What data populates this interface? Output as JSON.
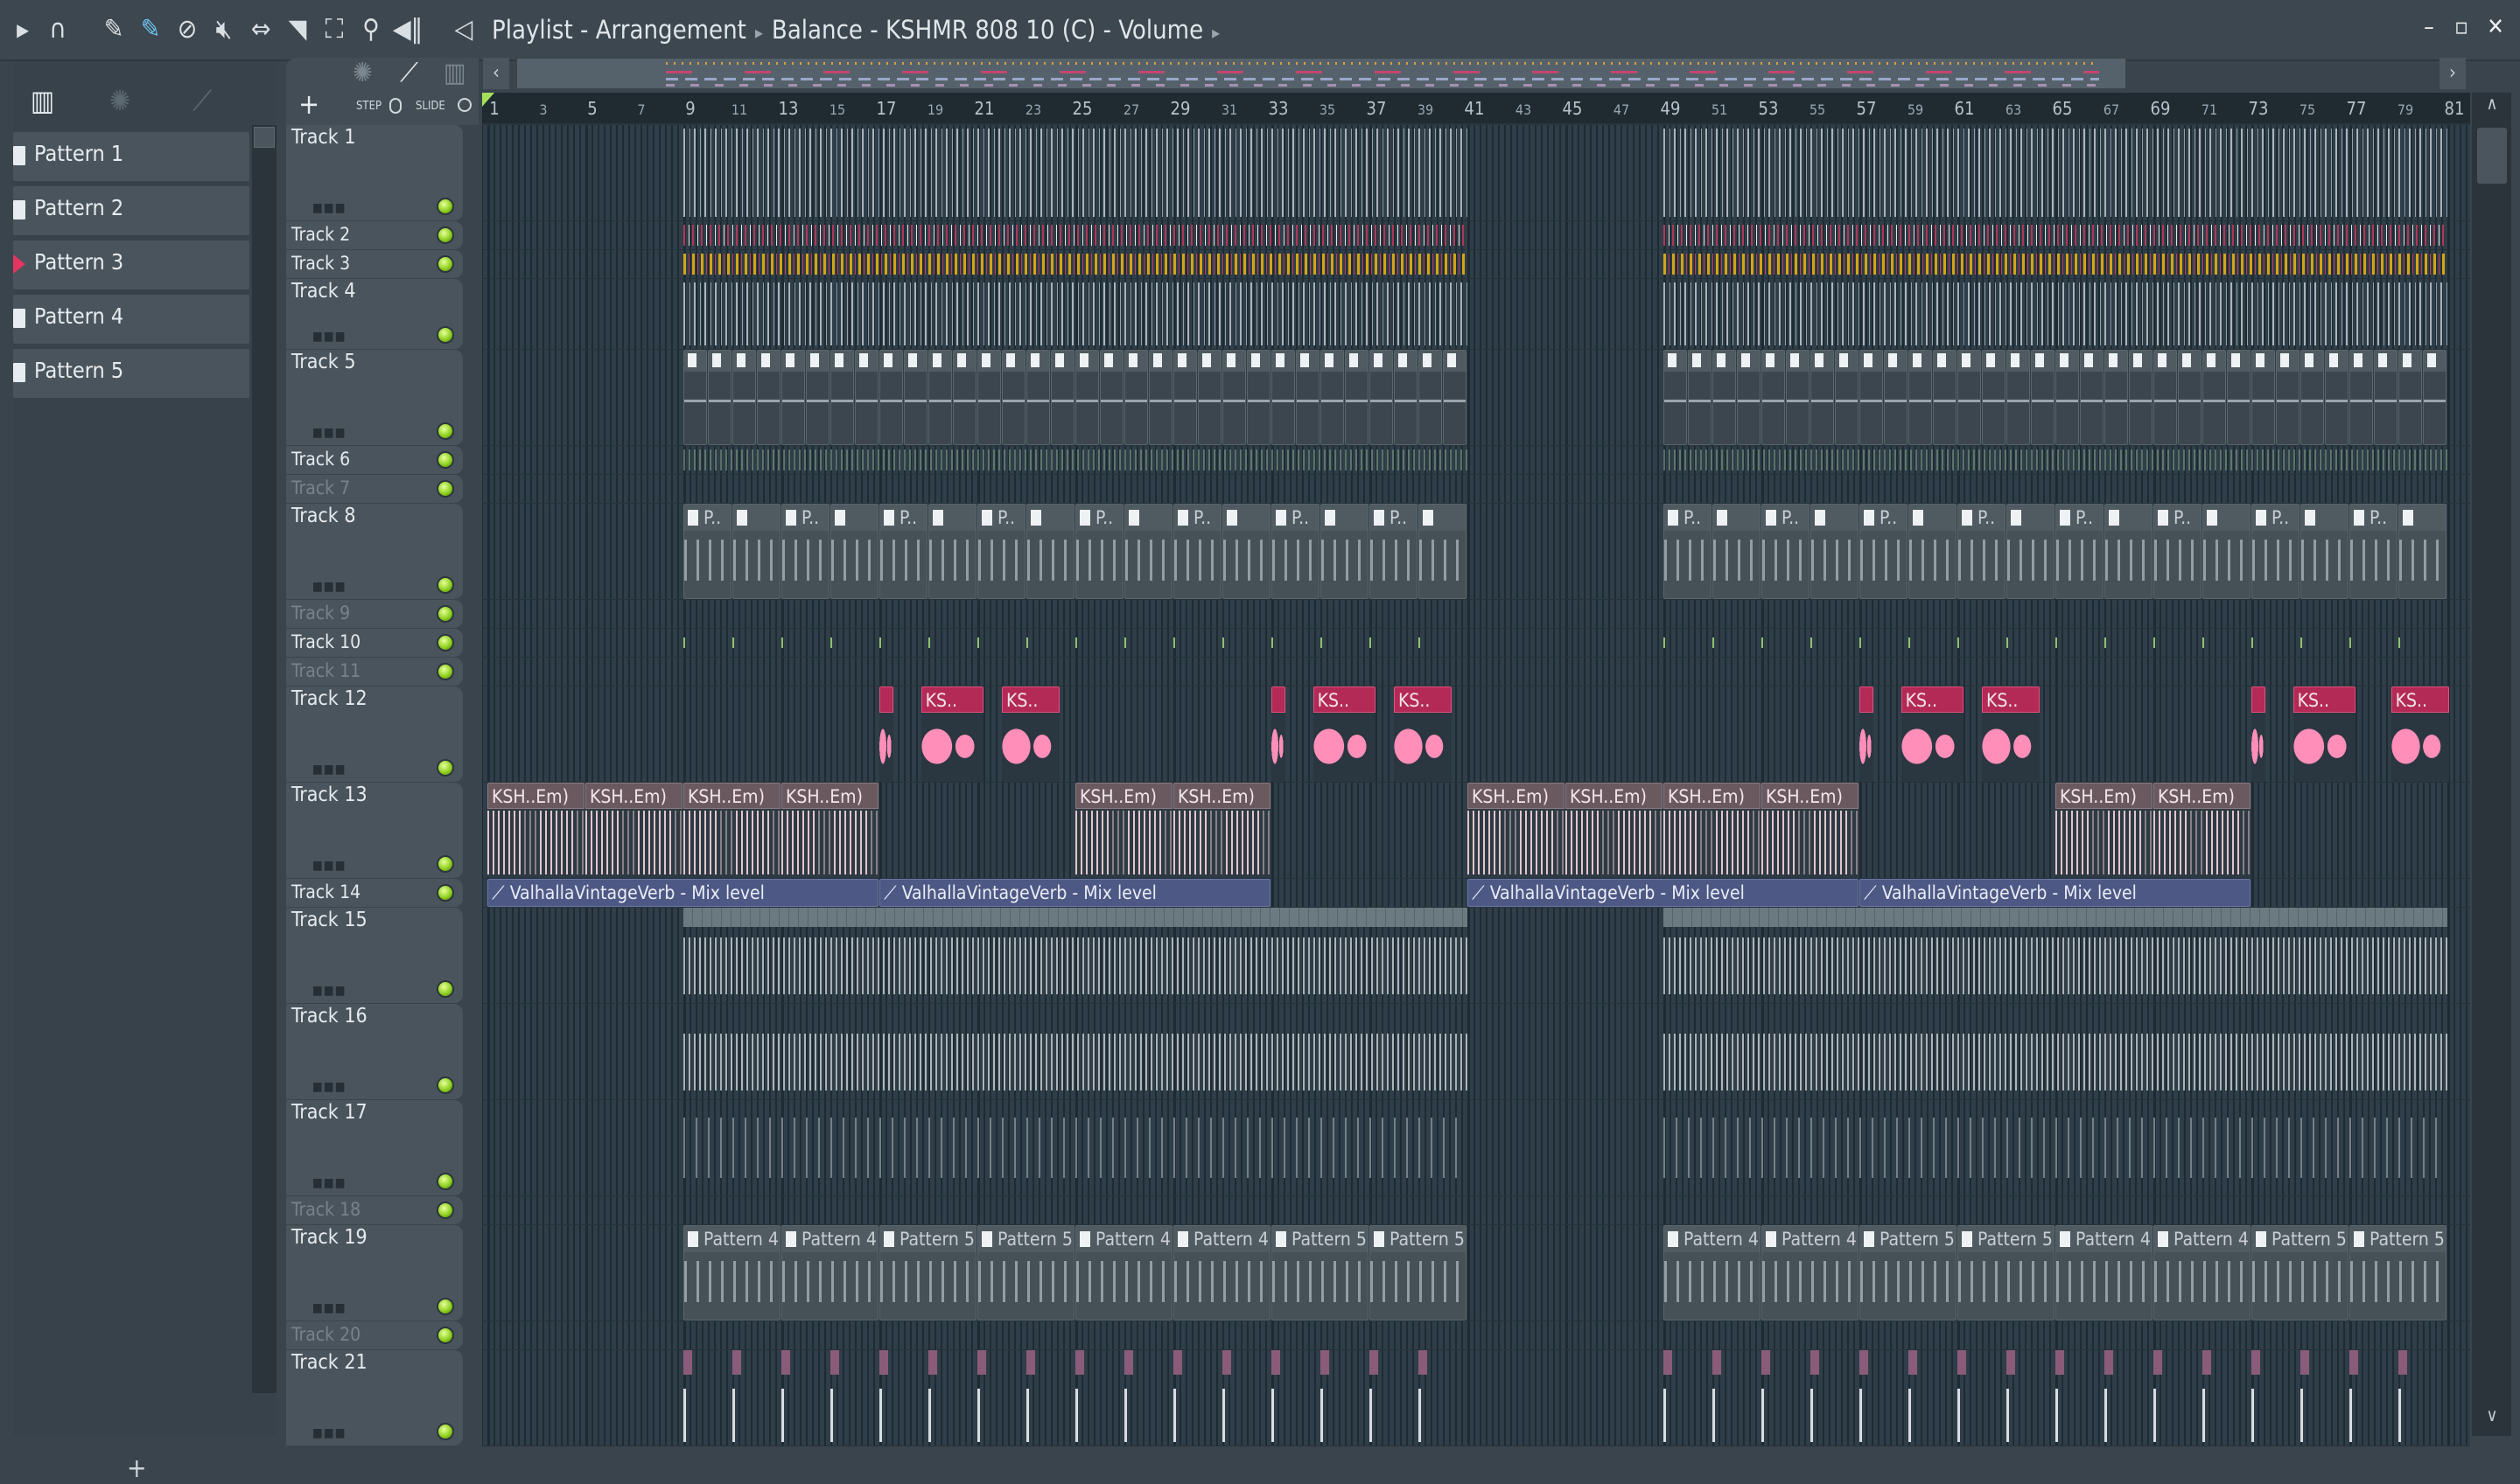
{
  "toolbar": {
    "icons": [
      "play-arrow-icon",
      "magnet-snap-icon",
      "pencil-icon",
      "paint-icon",
      "delete-icon",
      "mute-icon",
      "slip-icon",
      "slice-icon",
      "select-icon",
      "zoom-icon",
      "playback-icon"
    ],
    "title": "Playlist - Arrangement",
    "subtitle": "Balance - KSHMR 808 10 (C) - Volume",
    "separator": "▸"
  },
  "header_tools": {
    "add": "+",
    "step": "STEP",
    "slide": "SLIDE"
  },
  "patterns": [
    {
      "name": "Pattern 1"
    },
    {
      "name": "Pattern 2"
    },
    {
      "name": "Pattern 3",
      "playing": true
    },
    {
      "name": "Pattern 4"
    },
    {
      "name": "Pattern 5"
    }
  ],
  "add_pattern": "+",
  "ruler": {
    "labels": [
      1,
      3,
      5,
      7,
      9,
      11,
      13,
      15,
      17,
      19,
      21,
      23,
      25,
      27,
      29,
      31,
      33,
      35,
      37,
      39,
      41,
      43,
      45,
      47,
      49,
      51,
      53,
      55,
      57,
      59,
      61,
      63,
      65,
      67,
      69,
      71,
      73,
      75,
      77,
      79,
      81
    ]
  },
  "tracks": [
    {
      "name": "Track 1",
      "regions": [
        [
          9,
          41,
          "white"
        ],
        [
          49,
          81,
          "white"
        ]
      ]
    },
    {
      "name": "Track 2",
      "regions": [
        [
          9,
          41,
          "red"
        ],
        [
          49,
          81,
          "red"
        ]
      ]
    },
    {
      "name": "Track 3",
      "regions": [
        [
          9,
          41,
          "yellow"
        ],
        [
          49,
          81,
          "yellow"
        ]
      ]
    },
    {
      "name": "Track 4",
      "regions": [
        [
          9,
          41,
          "white"
        ],
        [
          49,
          81,
          "white"
        ]
      ]
    },
    {
      "name": "Track 5",
      "runs": [
        {
          "from": 9,
          "to": 41,
          "step": 1,
          "kind": "small",
          "labels": [
            ""
          ]
        },
        {
          "from": 49,
          "to": 81,
          "step": 1,
          "kind": "small",
          "labels": [
            ""
          ]
        }
      ]
    },
    {
      "name": "Track 6",
      "regions": [
        [
          9,
          41,
          "green"
        ],
        [
          49,
          81,
          "green"
        ]
      ]
    },
    {
      "name": "Track 7",
      "dim": true
    },
    {
      "name": "Track 8",
      "runs": [
        {
          "from": 9,
          "to": 41,
          "step": 2,
          "kind": "pat",
          "labels": [
            "P..",
            ""
          ]
        },
        {
          "from": 49,
          "to": 81,
          "step": 2,
          "kind": "pat",
          "labels": [
            "P..",
            ""
          ]
        }
      ]
    },
    {
      "name": "Track 9",
      "dim": true
    },
    {
      "name": "Track 10",
      "regions": [
        [
          9,
          41,
          "tick"
        ],
        [
          49,
          81,
          "tick"
        ]
      ]
    },
    {
      "name": "Track 11",
      "dim": true
    },
    {
      "name": "Track 12",
      "clips": [
        {
          "start": 17,
          "len": 0.6,
          "label": "",
          "kind": "pink"
        },
        {
          "start": 18.7,
          "len": 2.6,
          "label": "KS..",
          "kind": "pink"
        },
        {
          "start": 22,
          "len": 2.4,
          "label": "KS..",
          "kind": "pink"
        },
        {
          "start": 33,
          "len": 0.6,
          "label": "",
          "kind": "pink"
        },
        {
          "start": 34.7,
          "len": 2.6,
          "label": "KS..",
          "kind": "pink"
        },
        {
          "start": 38,
          "len": 2.4,
          "label": "KS..",
          "kind": "pink"
        },
        {
          "start": 57,
          "len": 0.6,
          "label": "",
          "kind": "pink"
        },
        {
          "start": 58.7,
          "len": 2.6,
          "label": "KS..",
          "kind": "pink"
        },
        {
          "start": 62,
          "len": 2.4,
          "label": "KS..",
          "kind": "pink"
        },
        {
          "start": 73,
          "len": 0.6,
          "label": "",
          "kind": "pink"
        },
        {
          "start": 74.7,
          "len": 2.6,
          "label": "KS..",
          "kind": "pink"
        },
        {
          "start": 78.7,
          "len": 2.4,
          "label": "KS..",
          "kind": "pink"
        }
      ]
    },
    {
      "name": "Track 13",
      "runs": [
        {
          "from": 1,
          "to": 17,
          "step": 4,
          "kind": "ksh",
          "labels": [
            "KSH..Em)"
          ]
        },
        {
          "from": 25,
          "to": 33,
          "step": 4,
          "kind": "ksh",
          "labels": [
            "KSH..Em)"
          ]
        },
        {
          "from": 41,
          "to": 57,
          "step": 4,
          "kind": "ksh",
          "labels": [
            "KSH..Em)"
          ]
        },
        {
          "from": 65,
          "to": 73,
          "step": 4,
          "kind": "ksh",
          "labels": [
            "KSH..Em)"
          ]
        }
      ]
    },
    {
      "name": "Track 14",
      "runs": [
        {
          "from": 1,
          "to": 33,
          "step": 16,
          "kind": "auto",
          "labels": [
            "ValhallaVintageVerb - Mix level"
          ]
        },
        {
          "from": 41,
          "to": 73,
          "step": 16,
          "kind": "auto",
          "labels": [
            "ValhallaVintageVerb - Mix level"
          ]
        }
      ]
    },
    {
      "name": "Track 15",
      "regions": [
        [
          9,
          41,
          "combhead"
        ],
        [
          9,
          41,
          "comb"
        ],
        [
          49,
          81,
          "combhead"
        ],
        [
          49,
          81,
          "comb"
        ]
      ]
    },
    {
      "name": "Track 16",
      "regions": [
        [
          9,
          41,
          "comb"
        ],
        [
          49,
          81,
          "comb"
        ]
      ]
    },
    {
      "name": "Track 17",
      "regions": [
        [
          9,
          41,
          "sparse"
        ],
        [
          49,
          81,
          "sparse"
        ]
      ]
    },
    {
      "name": "Track 18",
      "dim": true
    },
    {
      "name": "Track 19",
      "runs": [
        {
          "from": 9,
          "to": 41,
          "step": 4,
          "kind": "pat",
          "labels": [
            "Pattern 4",
            "Pattern 4",
            "Pattern 5",
            "Pattern 5"
          ]
        },
        {
          "from": 49,
          "to": 81,
          "step": 4,
          "kind": "pat",
          "labels": [
            "Pattern 4",
            "Pattern 4",
            "Pattern 5",
            "Pattern 5"
          ]
        }
      ]
    },
    {
      "name": "Track 20",
      "dim": true
    },
    {
      "name": "Track 21",
      "regions": [
        [
          9,
          41,
          "kick"
        ],
        [
          9,
          41,
          "kick2"
        ],
        [
          49,
          81,
          "kick"
        ],
        [
          49,
          81,
          "kick2"
        ]
      ]
    }
  ]
}
